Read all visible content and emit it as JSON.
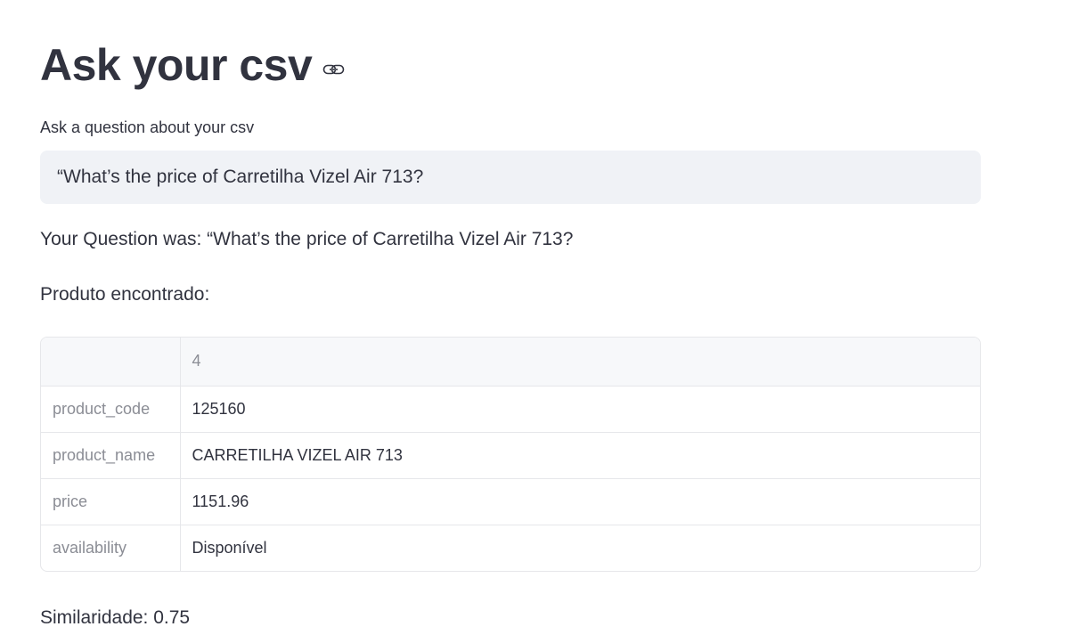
{
  "page": {
    "title": "Ask your csv"
  },
  "question": {
    "label": "Ask a question about your csv",
    "value": "“What’s the price of Carretilha Vizel Air 713?"
  },
  "answer": {
    "text": "Your Question was: “What’s the price of Carretilha Vizel Air 713?",
    "found_label": "Produto encontrado:"
  },
  "table": {
    "index_header": "",
    "column_header": "4",
    "rows": [
      {
        "key": "product_code",
        "value": "125160"
      },
      {
        "key": "product_name",
        "value": "CARRETILHA VIZEL AIR 713"
      },
      {
        "key": "price",
        "value": "1151.96"
      },
      {
        "key": "availability",
        "value": "Disponível"
      }
    ]
  },
  "similarity": {
    "text": "Similaridade: 0.75"
  },
  "colors": {
    "text": "#31333f",
    "muted": "#8b8d95",
    "input_bg": "#f0f2f6",
    "border": "#e6e7ea"
  },
  "icons": {
    "title_anchor": "link-icon"
  }
}
